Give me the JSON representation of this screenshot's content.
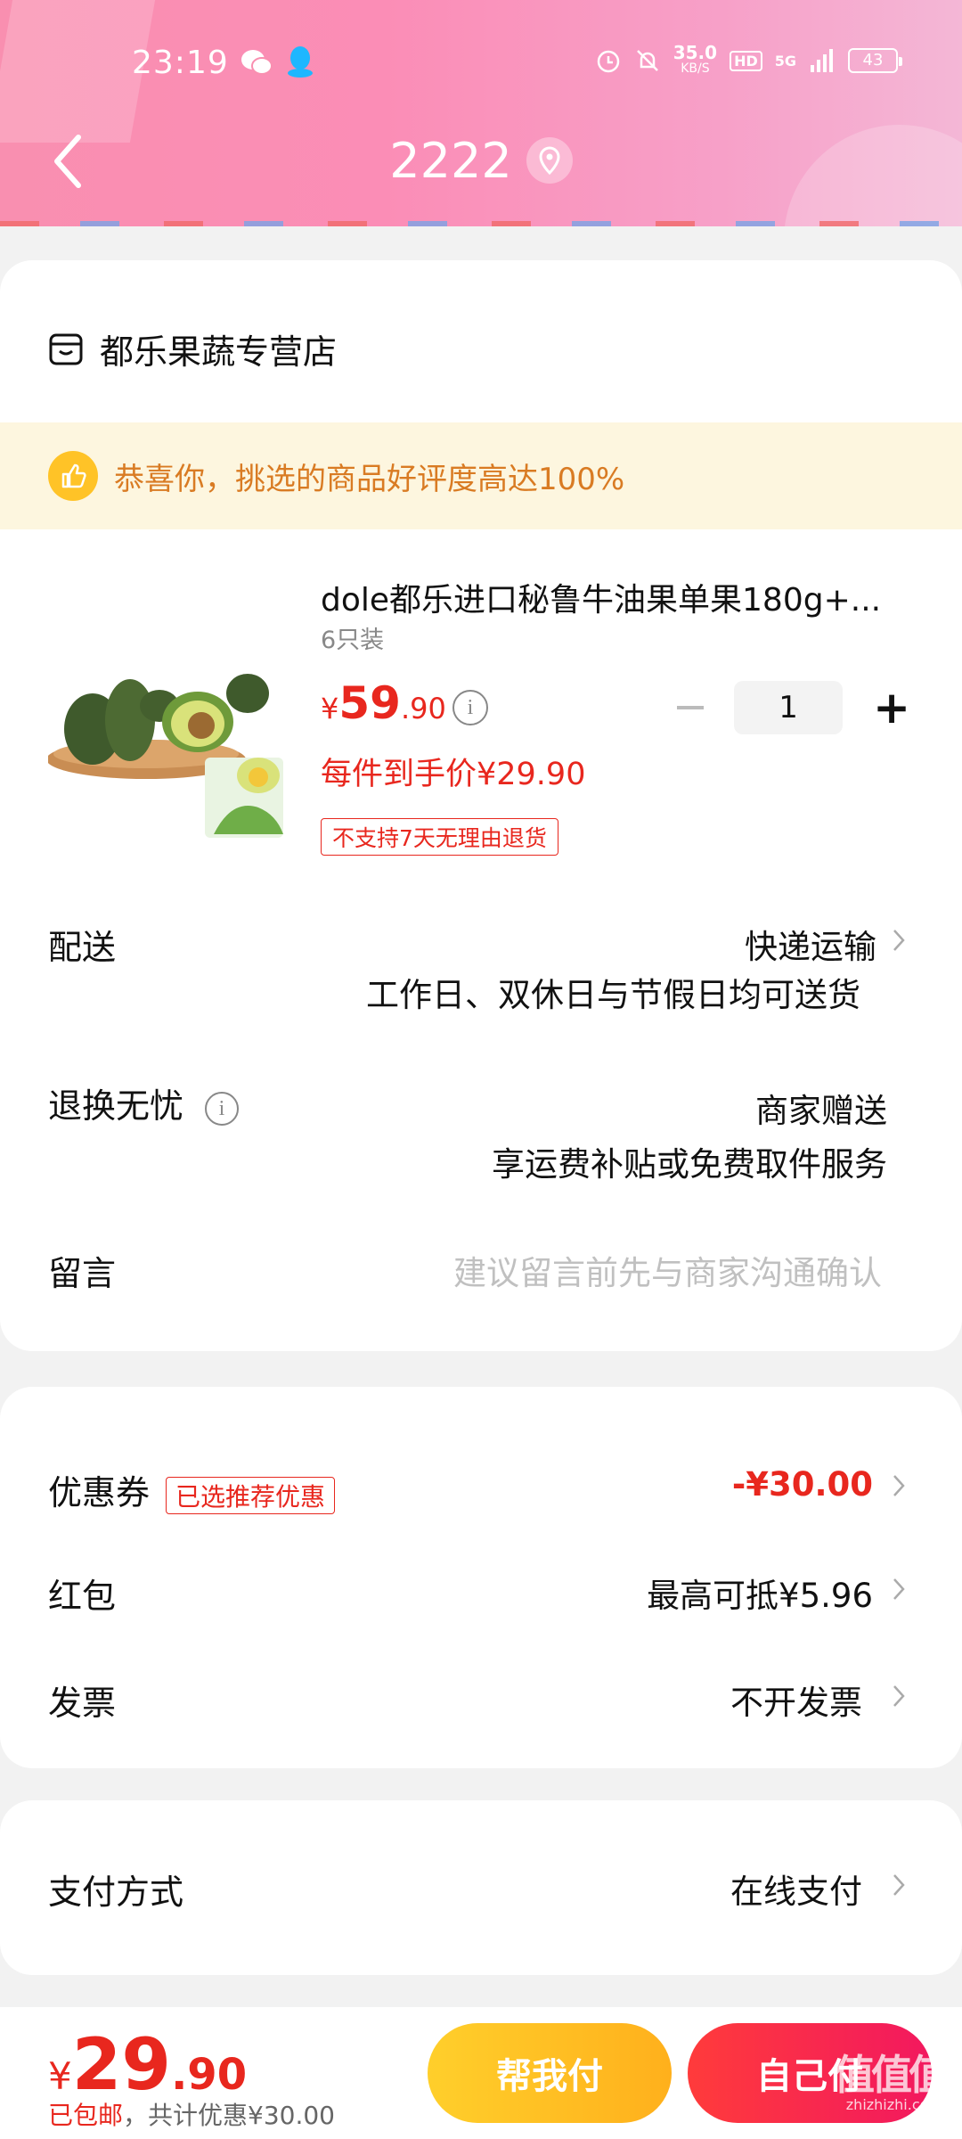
{
  "status_bar": {
    "time": "23:19",
    "net_speed": "35.0",
    "net_unit": "KB/S",
    "hd": "HD",
    "signal": "5G",
    "battery": "43"
  },
  "header": {
    "title": "2222"
  },
  "store": {
    "name": "都乐果蔬专营店"
  },
  "banner": {
    "text": "恭喜你，挑选的商品好评度高达100%"
  },
  "product": {
    "title": "dole都乐进口秘鲁牛油果单果180g+...",
    "spec": "6只装",
    "price_symbol": "¥",
    "price_int": "59",
    "price_dec": ".90",
    "after_price": "每件到手价¥29.90",
    "tag": "不支持7天无理由退货",
    "quantity": "1"
  },
  "rows": {
    "delivery_label": "配送",
    "delivery_value": "快递运输",
    "delivery_note": "工作日、双休日与节假日均可送货",
    "return_label": "退换无忧",
    "return_value": "商家赠送",
    "return_note": "享运费补贴或免费取件服务",
    "message_label": "留言",
    "message_placeholder": "建议留言前先与商家沟通确认"
  },
  "discounts": {
    "coupon_label": "优惠券",
    "coupon_tag": "已选推荐优惠",
    "coupon_value": "-¥30.00",
    "hongbao_label": "红包",
    "hongbao_value": "最高可抵¥5.96",
    "invoice_label": "发票",
    "invoice_value": "不开发票"
  },
  "payment": {
    "label": "支付方式",
    "value": "在线支付"
  },
  "bottom": {
    "total_symbol": "¥",
    "total_int": "29",
    "total_dec": ".90",
    "shipping": "已包邮",
    "saved": "，共计优惠¥30.00",
    "help_pay": "帮我付",
    "self_pay": "自己付",
    "watermark": "值值值",
    "watermark_sub": "zhizhizhi.com"
  },
  "colors": {
    "accent_red": "#e8271e",
    "header_pink": "#fb8db6",
    "banner_orange": "#d97b23"
  }
}
